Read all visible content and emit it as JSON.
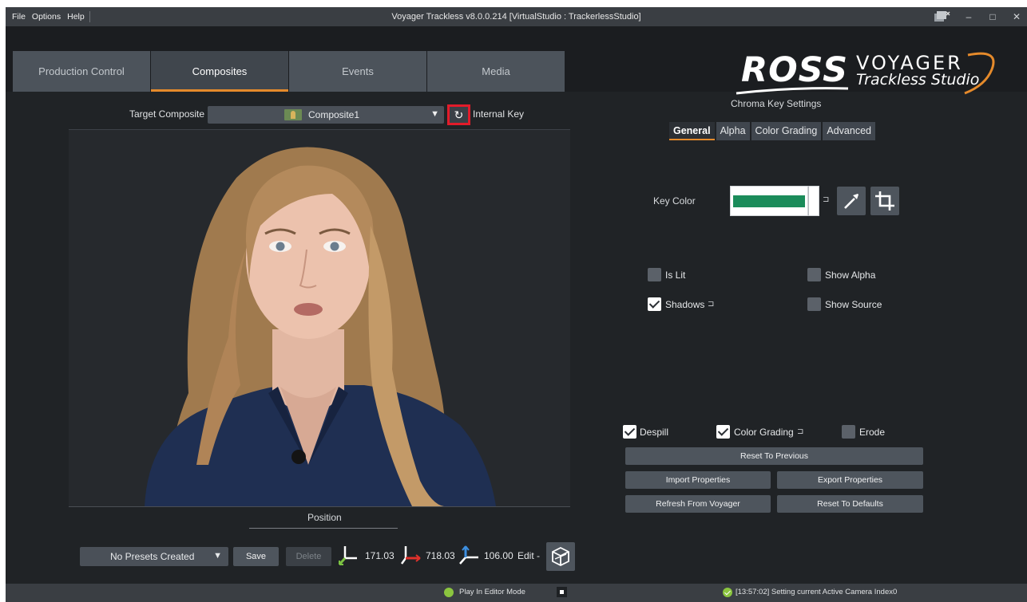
{
  "menu": {
    "file": "File",
    "options": "Options",
    "help": "Help"
  },
  "window": {
    "title": "Voyager Trackless v8.0.0.214 [VirtualStudio : TrackerlessStudio]",
    "minimize": "–",
    "maximize": "□",
    "close": "✕"
  },
  "tabs": [
    {
      "label": "Production Control",
      "active": false
    },
    {
      "label": "Composites",
      "active": true
    },
    {
      "label": "Events",
      "active": false
    },
    {
      "label": "Media",
      "active": false
    }
  ],
  "logo": {
    "brand": "ROSS",
    "product_line1": "VOYAGER",
    "product_line2": "Trackless Studio"
  },
  "composite": {
    "target_label": "Target Composite",
    "selected": "Composite1",
    "internal_key_label": "Internal Key",
    "refresh_icon": "↻"
  },
  "position": {
    "label": "Position",
    "presets_placeholder": "No Presets Created",
    "save_label": "Save",
    "delete_label": "Delete",
    "x": "171.03",
    "y": "718.03",
    "z": "106.00",
    "edit_label": "Edit -"
  },
  "chroma": {
    "title": "Chroma Key Settings",
    "subtabs": [
      {
        "label": "General",
        "active": true
      },
      {
        "label": "Alpha",
        "active": false
      },
      {
        "label": "Color Grading",
        "active": false
      },
      {
        "label": "Advanced",
        "active": false
      }
    ],
    "key_color_label": "Key Color",
    "key_color": "#1b8c5a",
    "reset_glyph": "⊐",
    "checks": {
      "is_lit": {
        "label": "Is Lit",
        "checked": false
      },
      "show_alpha": {
        "label": "Show Alpha",
        "checked": false
      },
      "shadows": {
        "label": "Shadows",
        "checked": true
      },
      "show_source": {
        "label": "Show Source",
        "checked": false
      },
      "despill": {
        "label": "Despill",
        "checked": true
      },
      "color_grading": {
        "label": "Color Grading",
        "checked": true
      },
      "erode": {
        "label": "Erode",
        "checked": false
      }
    },
    "buttons": {
      "reset_previous": "Reset To Previous",
      "import": "Import Properties",
      "export": "Export Properties",
      "refresh": "Refresh From Voyager",
      "reset_defaults": "Reset To Defaults"
    }
  },
  "status": {
    "play_mode": "Play In Editor Mode",
    "message": "[13:57:02] Setting current Active Camera Index0"
  },
  "colors": {
    "accent": "#e58a2b",
    "highlight": "#e21b2a",
    "ok": "#8bc53f"
  }
}
